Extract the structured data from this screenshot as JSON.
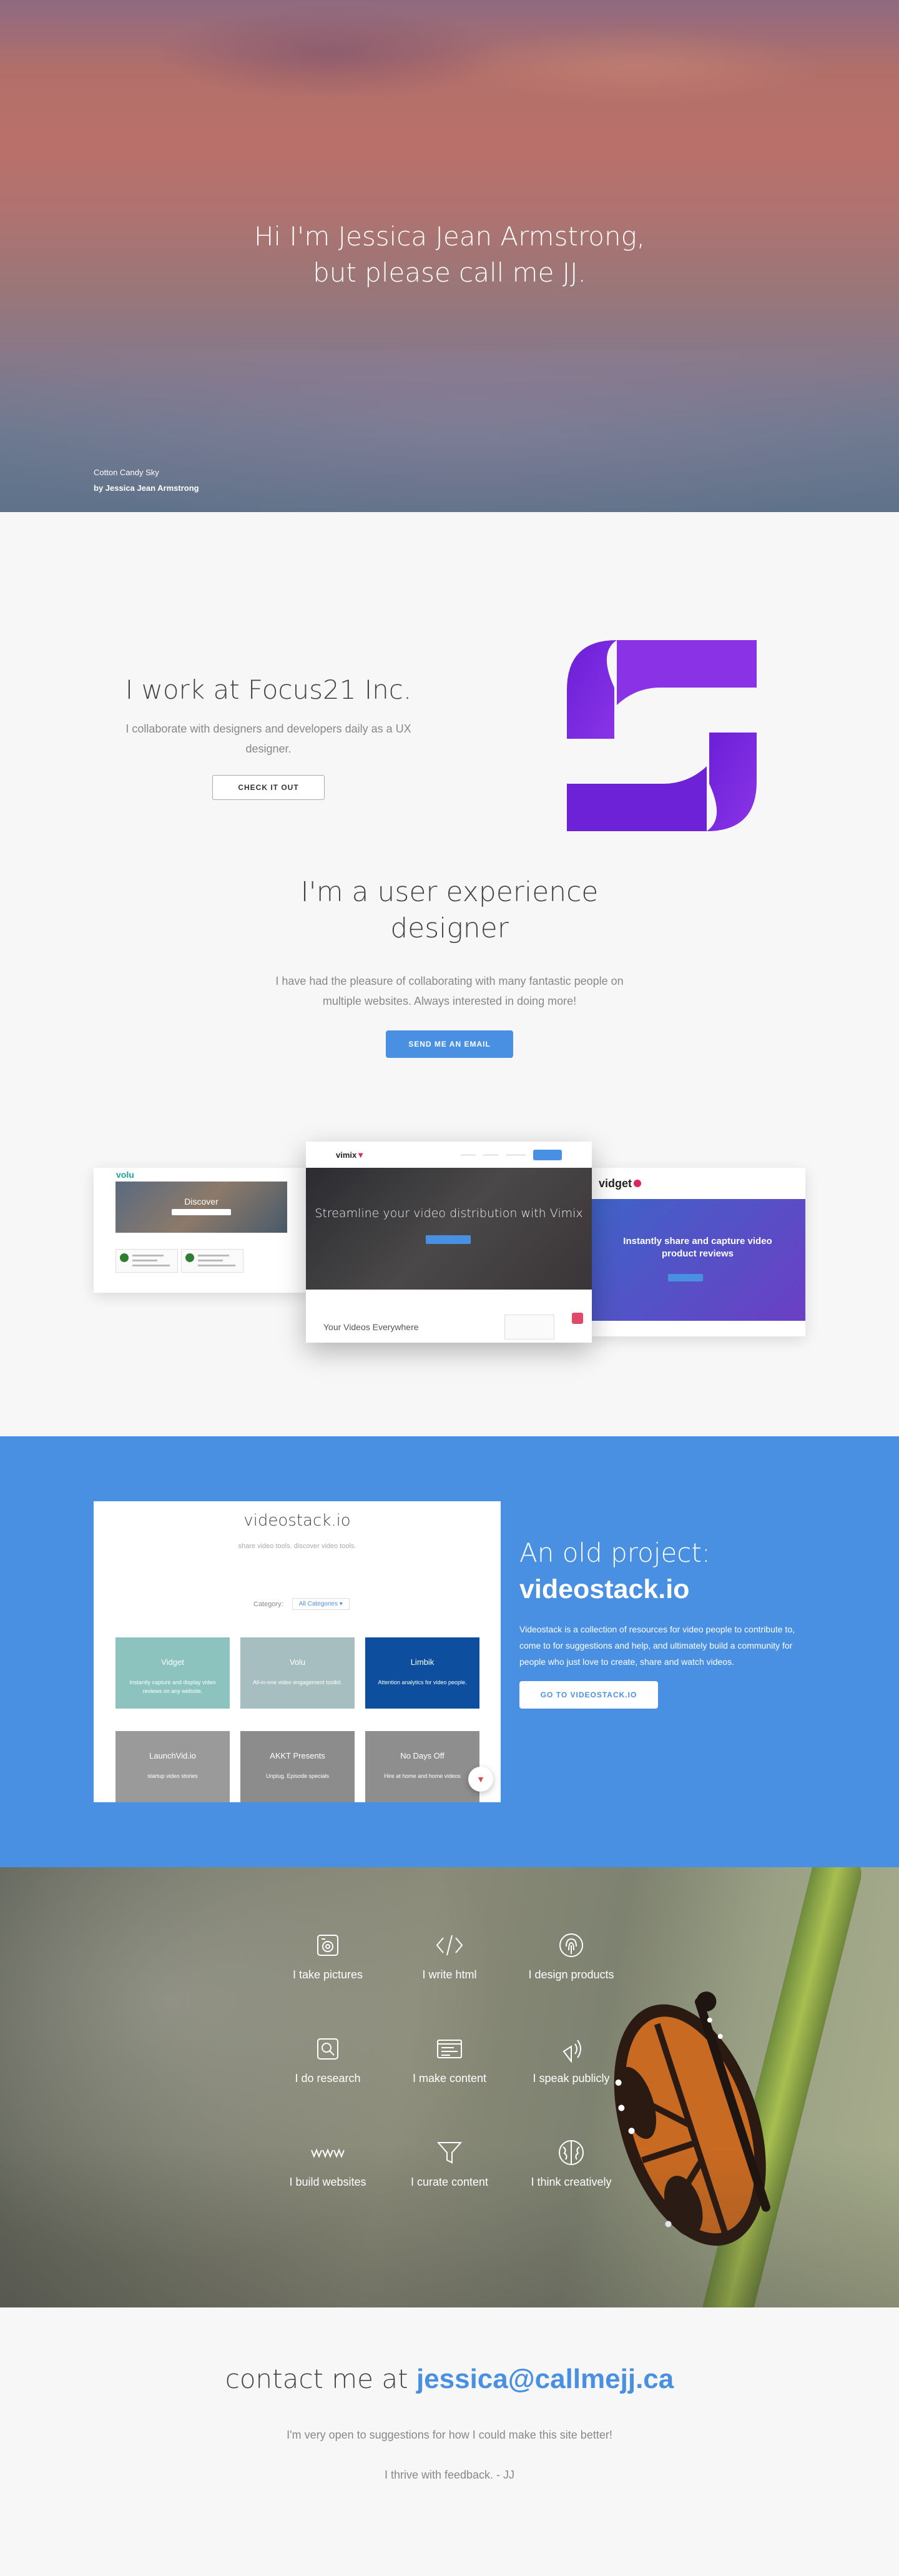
{
  "hero": {
    "title_line1": "Hi I'm Jessica Jean Armstrong,",
    "title_line2": "but please call me JJ.",
    "photo_title": "Cotton Candy Sky",
    "photo_by": "by Jessica Jean Armstrong"
  },
  "focus": {
    "heading": "I work at Focus21 Inc.",
    "body": "I collaborate with designers and developers daily as a UX designer.",
    "button": "CHECK IT OUT",
    "logo_color": "#7b2ae0"
  },
  "ux": {
    "heading_line1": "I'm a user experience",
    "heading_line2": "designer",
    "body": "I have had the pleasure of collaborating with many fantastic people on multiple websites. Always interested in doing more!",
    "button": "SEND ME AN EMAIL",
    "shots": {
      "volu": {
        "logo": "volu",
        "hero_title": "Discover"
      },
      "vimix": {
        "logo": "vimix",
        "hero_title": "Streamline your video distribution with Vimix",
        "footer": "Your Videos Everywhere"
      },
      "vidget": {
        "logo": "vidget",
        "hero_title": "Instantly share and capture video product reviews"
      }
    }
  },
  "old_project": {
    "heading_light": "An old project:",
    "heading_bold": "videostack.io",
    "body": "Videostack is a collection of resources for video people to contribute to, come to for suggestions and help, and ultimately build a community for people who just love to create, share and watch videos.",
    "button": "GO TO VIDEOSTACK.IO",
    "screenshot": {
      "title": "videostack.io",
      "subtitle": "share video tools. discover video tools.",
      "category_label": "Category:",
      "category_value": "All Categories ▾",
      "tiles": [
        {
          "name": "Vidget",
          "desc": "Instantly capture and display video reviews on any website.",
          "color": "#8cc3bf"
        },
        {
          "name": "Volu",
          "desc": "All-in-one video engagement toolkit.",
          "color": "#a7bec0"
        },
        {
          "name": "Limbik",
          "desc": "Attention analytics for video people.",
          "color": "#0d4f9e"
        },
        {
          "name": "LaunchVid.io",
          "desc": "startup video stories",
          "color": "#9a9a9a"
        },
        {
          "name": "AKKT Presents",
          "desc": "Unplug. Episode specials",
          "color": "#8c8c8c"
        },
        {
          "name": "No Days Off",
          "desc": "Hire at home and home videos",
          "color": "#8e8e8e"
        }
      ]
    }
  },
  "skills": [
    {
      "label": "I take pictures",
      "icon": "camera-icon"
    },
    {
      "label": "I write html",
      "icon": "code-icon"
    },
    {
      "label": "I design products",
      "icon": "fingerprint-icon"
    },
    {
      "label": "I do research",
      "icon": "research-icon"
    },
    {
      "label": "I make content",
      "icon": "content-icon"
    },
    {
      "label": "I speak publicly",
      "icon": "speaker-icon"
    },
    {
      "label": "I build websites",
      "icon": "www-icon"
    },
    {
      "label": "I curate content",
      "icon": "funnel-icon"
    },
    {
      "label": "I think creatively",
      "icon": "brain-icon"
    }
  ],
  "contact": {
    "prefix": "contact me at",
    "email": "jessica@callmejj.ca",
    "line1": "I'm very open to suggestions for how I could make this site better!",
    "line2": "I thrive with feedback. - JJ"
  },
  "colors": {
    "accent": "#4a90e2",
    "purple": "#7b2ae0"
  }
}
